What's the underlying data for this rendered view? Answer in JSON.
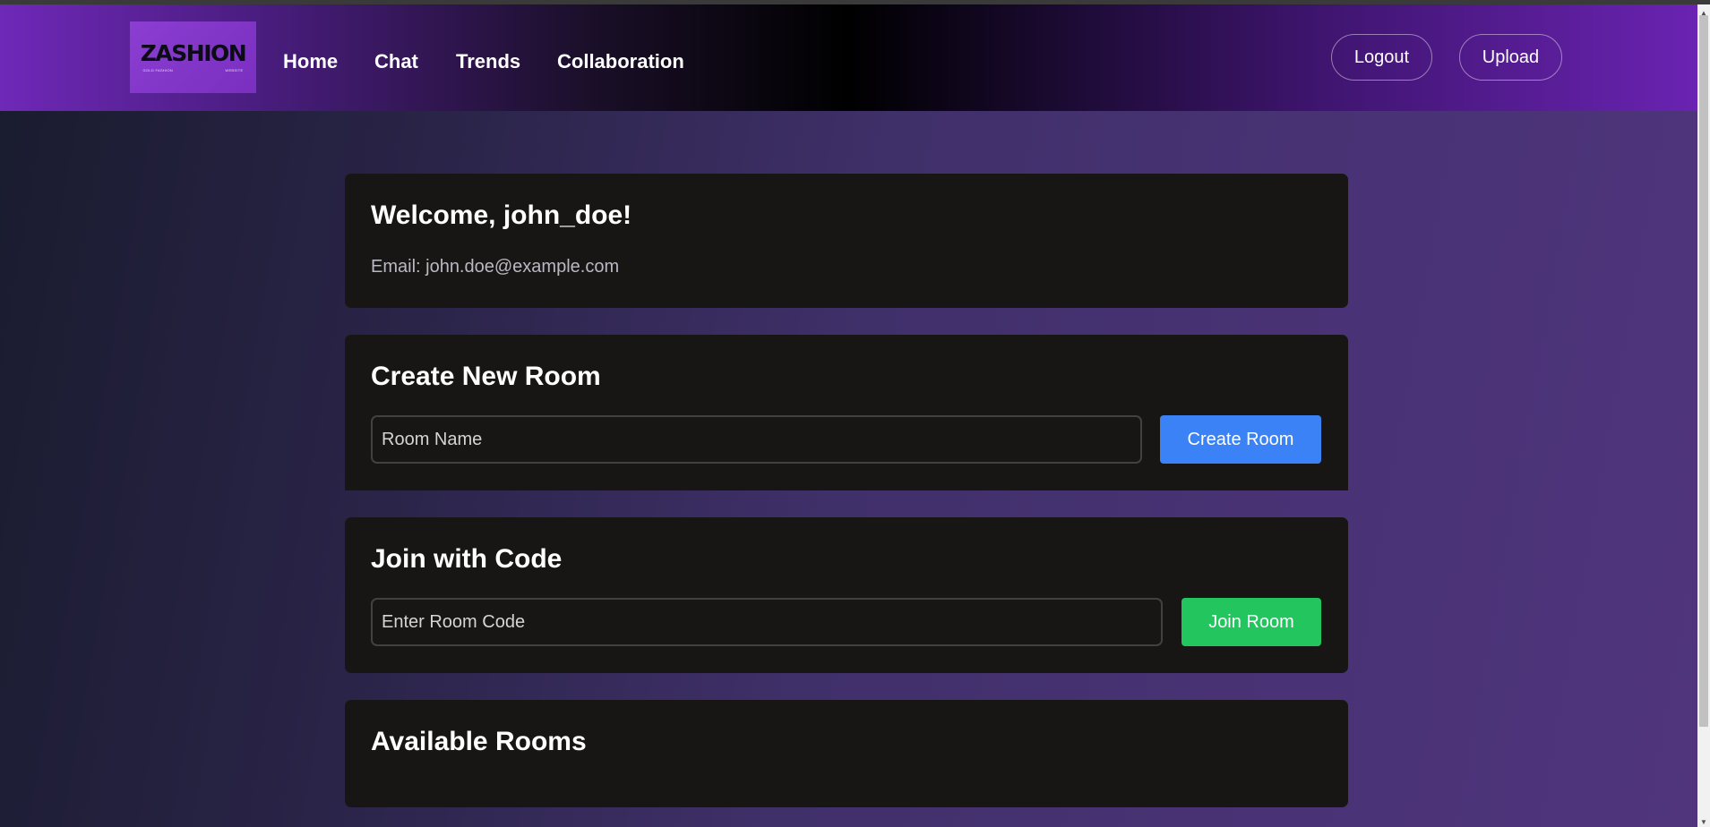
{
  "logo": {
    "wordmark": "ZASHION",
    "tagline_left": "GOLD FASHION",
    "tagline_right": "WEBSITE"
  },
  "nav": {
    "links": [
      "Home",
      "Chat",
      "Trends",
      "Collaboration"
    ],
    "logout_label": "Logout",
    "upload_label": "Upload"
  },
  "welcome": {
    "title": "Welcome, john_doe!",
    "email": "Email: john.doe@example.com"
  },
  "create_room": {
    "title": "Create New Room",
    "input_placeholder": "Room Name",
    "button_label": "Create Room",
    "button_color": "#3b82f6"
  },
  "join_room": {
    "title": "Join with Code",
    "input_placeholder": "Enter Room Code",
    "button_label": "Join Room",
    "button_color": "#22c55e"
  },
  "available_rooms": {
    "title": "Available Rooms"
  }
}
